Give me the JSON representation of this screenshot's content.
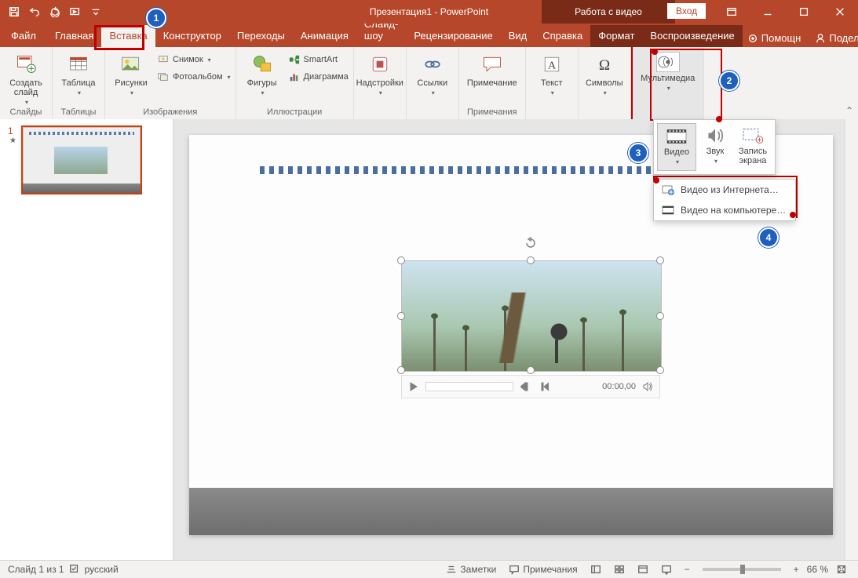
{
  "title": "Презентация1 - PowerPoint",
  "toolTab": "Работа с видео",
  "login": "Вход",
  "tabs": {
    "file": "Файл",
    "home": "Главная",
    "insert": "Вставка",
    "design": "Конструктор",
    "transitions": "Переходы",
    "animations": "Анимация",
    "slideshow": "Слайд-шоу",
    "review": "Рецензирование",
    "view": "Вид",
    "help": "Справка",
    "format": "Формат",
    "playback": "Воспроизведение"
  },
  "helpArea": {
    "tell": "Помощн",
    "share": "Поделиться"
  },
  "ribbon": {
    "slides": {
      "newSlide": "Создать\nслайд",
      "group": "Слайды"
    },
    "tables": {
      "table": "Таблица",
      "group": "Таблицы"
    },
    "images": {
      "pictures": "Рисунки",
      "screenshot": "Снимок",
      "album": "Фотоальбом",
      "group": "Изображения"
    },
    "illus": {
      "shapes": "Фигуры",
      "smartart": "SmartArt",
      "chart": "Диаграмма",
      "group": "Иллюстрации"
    },
    "addins": {
      "addins": "Надстройки",
      "group": ""
    },
    "links": {
      "links": "Ссылки",
      "group": ""
    },
    "comments": {
      "comment": "Примечание",
      "group": "Примечания"
    },
    "text": {
      "text": "Текст",
      "group": ""
    },
    "symbols": {
      "symbols": "Символы",
      "group": ""
    },
    "media": {
      "media": "Мультимедиа",
      "group": "",
      "video": "Видео",
      "audio": "Звук",
      "screenrec": "Запись\nэкрана",
      "menu1": "Видео из Интернета…",
      "menu2": "Видео на компьютере…"
    }
  },
  "playbar": {
    "time": "00:00,00"
  },
  "status": {
    "slideCount": "Слайд 1 из 1",
    "lang": "русский",
    "notes": "Заметки",
    "comments": "Примечания",
    "zoom": "66 %"
  },
  "thumb": {
    "num": "1"
  },
  "anno": {
    "a1": "1",
    "a2": "2",
    "a3": "3",
    "a4": "4"
  }
}
